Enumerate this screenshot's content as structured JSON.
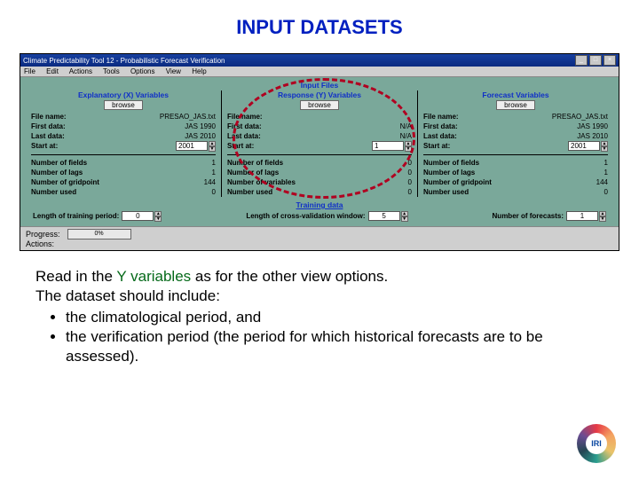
{
  "header": {
    "title": "INPUT DATASETS"
  },
  "window": {
    "title": "Climate Predictability Tool 12 - Probabilistic Forecast Verification",
    "menus": [
      "File",
      "Edit",
      "Actions",
      "Tools",
      "Options",
      "View",
      "Help"
    ],
    "input_files_label": "Input Files",
    "columns": {
      "x": {
        "heading": "Explanatory (X) Variables",
        "browse": "browse",
        "file_name_label": "File name:",
        "file_name": "PRESAO_JAS.txt",
        "first_data_label": "First data:",
        "first_data": "JAS 1990",
        "last_data_label": "Last data:",
        "last_data": "JAS 2010",
        "start_at_label": "Start at:",
        "start_at": "2001",
        "fields_label": "Number of fields",
        "fields": "1",
        "lags_label": "Number of lags",
        "lags": "1",
        "gp_label": "Number of gridpoint",
        "gp": "144",
        "used_label": "Number used",
        "used": "0"
      },
      "y": {
        "heading": "Response (Y) Variables",
        "browse": "browse",
        "file_name_label": "File name:",
        "file_name": "",
        "first_data_label": "First data:",
        "first_data": "N/A",
        "last_data_label": "Last data:",
        "last_data": "N/A",
        "start_at_label": "Start at:",
        "start_at": "1",
        "fields_label": "Number of fields",
        "fields": "0",
        "lags_label": "Number of lags",
        "lags": "0",
        "vars_label": "Number of variables",
        "vars": "0",
        "used_label": "Number used",
        "used": "0"
      },
      "f": {
        "heading": "Forecast Variables",
        "browse": "browse",
        "file_name_label": "File name:",
        "file_name": "PRESAO_JAS.txt",
        "first_data_label": "First data:",
        "first_data": "JAS 1990",
        "last_data_label": "Last data:",
        "last_data": "JAS 2010",
        "start_at_label": "Start at:",
        "start_at": "2001",
        "fields_label": "Number of fields",
        "fields": "1",
        "lags_label": "Number of lags",
        "lags": "1",
        "gp_label": "Number of gridpoint",
        "gp": "144",
        "used_label": "Number used",
        "used": "0"
      }
    },
    "training": {
      "heading": "Training data",
      "len_train_label": "Length of training period:",
      "len_train": "0",
      "len_cv_label": "Length of cross-validation window:",
      "len_cv": "5",
      "n_fc_label": "Number of forecasts:",
      "n_fc": "1"
    },
    "bottom": {
      "progress_label": "Progress:",
      "progress_pct": "0%",
      "actions_label": "Actions:"
    }
  },
  "instr": {
    "line1a": "Read in the ",
    "yvars": "Y variables",
    "line1b": " as for the other view options.",
    "line2": "The dataset should include:",
    "b1": "the climatological period, and",
    "b2": "the verification period (the period for which historical forecasts are to be assessed)."
  },
  "logo": {
    "text": "IRI"
  }
}
